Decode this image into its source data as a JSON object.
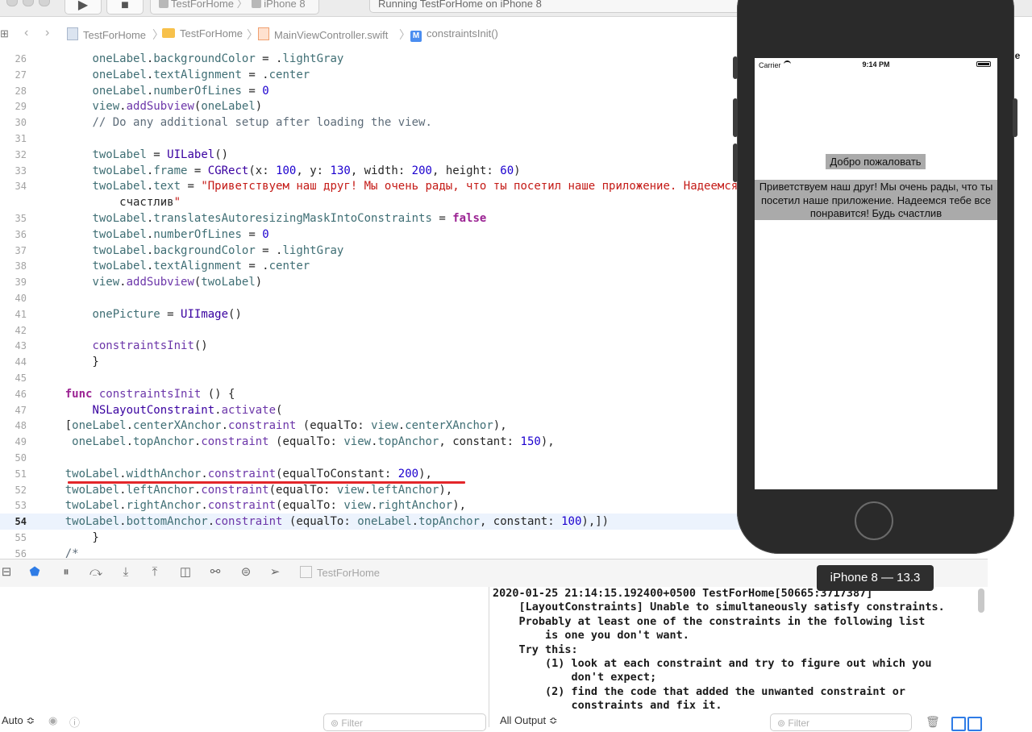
{
  "toolbar": {
    "run_icon": "play-icon",
    "stop_icon": "stop-icon",
    "scheme_target": "TestForHome",
    "scheme_device": "iPhone 8",
    "activity_status": "Running TestForHome on iPhone 8"
  },
  "jumpbar": {
    "project": "TestForHome",
    "group": "TestForHome",
    "file": "MainViewController.swift",
    "symbol_badge": "M",
    "symbol": "constraintsInit()"
  },
  "code_lines": [
    {
      "n": "26",
      "code": "        oneLabel.backgroundColor = .lightGray"
    },
    {
      "n": "27",
      "code": "        oneLabel.textAlignment = .center"
    },
    {
      "n": "28",
      "code": "        oneLabel.numberOfLines = 0"
    },
    {
      "n": "29",
      "code": "        view.addSubview(oneLabel)"
    },
    {
      "n": "30",
      "code": "        // Do any additional setup after loading the view."
    },
    {
      "n": "31",
      "code": ""
    },
    {
      "n": "32",
      "code": "        twoLabel = UILabel()"
    },
    {
      "n": "33",
      "code": "        twoLabel.frame = CGRect(x: 100, y: 130, width: 200, height: 60)"
    },
    {
      "n": "34",
      "code": "        twoLabel.text = \"Приветствуем наш друг! Мы очень рады, что ты посетил наше приложение. Надеемся"
    },
    {
      "n": "",
      "code": "            счастлив\""
    },
    {
      "n": "35",
      "code": "        twoLabel.translatesAutoresizingMaskIntoConstraints = false"
    },
    {
      "n": "36",
      "code": "        twoLabel.numberOfLines = 0"
    },
    {
      "n": "37",
      "code": "        twoLabel.backgroundColor = .lightGray"
    },
    {
      "n": "38",
      "code": "        twoLabel.textAlignment = .center"
    },
    {
      "n": "39",
      "code": "        view.addSubview(twoLabel)"
    },
    {
      "n": "40",
      "code": ""
    },
    {
      "n": "41",
      "code": "        onePicture = UIImage()"
    },
    {
      "n": "42",
      "code": ""
    },
    {
      "n": "43",
      "code": "        constraintsInit()"
    },
    {
      "n": "44",
      "code": "        }"
    },
    {
      "n": "45",
      "code": ""
    },
    {
      "n": "46",
      "code": "    func constraintsInit () {"
    },
    {
      "n": "47",
      "code": "        NSLayoutConstraint.activate("
    },
    {
      "n": "48",
      "code": "    [oneLabel.centerXAnchor.constraint (equalTo: view.centerXAnchor),"
    },
    {
      "n": "49",
      "code": "     oneLabel.topAnchor.constraint (equalTo: view.topAnchor, constant: 150),"
    },
    {
      "n": "50",
      "code": ""
    },
    {
      "n": "51",
      "code": "    twoLabel.widthAnchor.constraint(equalToConstant: 200),"
    },
    {
      "n": "52",
      "code": "    twoLabel.leftAnchor.constraint(equalTo: view.leftAnchor),"
    },
    {
      "n": "53",
      "code": "    twoLabel.rightAnchor.constraint(equalTo: view.rightAnchor),"
    },
    {
      "n": "54",
      "code": "    twoLabel.bottomAnchor.constraint (equalTo: oneLabel.topAnchor, constant: 100),])"
    },
    {
      "n": "55",
      "code": "        }"
    },
    {
      "n": "56",
      "code": "    /*"
    }
  ],
  "debug_bar": {
    "target": "TestForHome"
  },
  "console_lines": [
    "2020-01-25 21:14:15.192400+0500 TestForHome[50665:3717387]",
    "    [LayoutConstraints] Unable to simultaneously satisfy constraints.",
    "    Probably at least one of the constraints in the following list",
    "        is one you don't want.",
    "    Try this:",
    "        (1) look at each constraint and try to figure out which you",
    "            don't expect;",
    "        (2) find the code that added the unwanted constraint or",
    "            constraints and fix it."
  ],
  "footer": {
    "auto_label": "Auto ≎",
    "filter_placeholder": "Filter",
    "output_selector": "All Output ≎",
    "filter2_placeholder": "Filter"
  },
  "right_edge_text": "k He",
  "simulator": {
    "carrier": "Carrier",
    "time": "9:14 PM",
    "one_label": "Добро пожаловать",
    "two_label": "Приветствуем наш друг! Мы очень рады, что ты посетил наше приложение. Надеемся тебе все понравится! Будь счастлив",
    "tooltip": "iPhone 8 — 13.3"
  },
  "colors": {
    "keyword": "#9b2393",
    "property": "#3f6e74",
    "method": "#6c36a9",
    "number": "#1c00cf",
    "string": "#c41a16",
    "annotation_underline": "#e3262a",
    "current_line": "#ecf3fd"
  }
}
